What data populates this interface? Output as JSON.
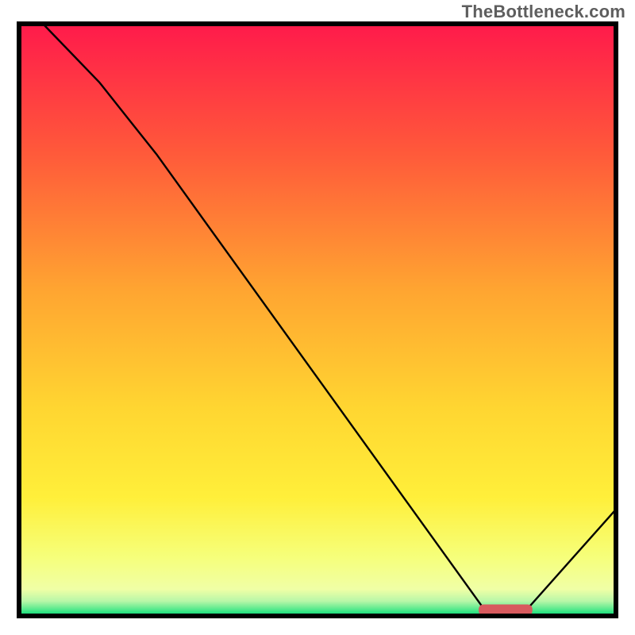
{
  "watermark": "TheBottleneck.com",
  "chart_data": {
    "type": "line",
    "title": "",
    "xlabel": "",
    "ylabel": "",
    "xlim": [
      0,
      100
    ],
    "ylim": [
      0,
      100
    ],
    "grid": false,
    "legend": false,
    "series": [
      {
        "name": "curve",
        "points": [
          {
            "x": 4,
            "y": 100
          },
          {
            "x": 23,
            "y": 78
          },
          {
            "x": 78,
            "y": 1
          },
          {
            "x": 85,
            "y": 1
          },
          {
            "x": 100,
            "y": 18
          }
        ]
      }
    ],
    "marker": {
      "x_start": 77,
      "x_end": 86,
      "y": 1,
      "color": "#d85a5e"
    },
    "gradient_stops": [
      {
        "offset": 0.0,
        "color": "#ff1a4b"
      },
      {
        "offset": 0.22,
        "color": "#ff5a3a"
      },
      {
        "offset": 0.45,
        "color": "#ffa531"
      },
      {
        "offset": 0.65,
        "color": "#ffd631"
      },
      {
        "offset": 0.8,
        "color": "#ffef3a"
      },
      {
        "offset": 0.9,
        "color": "#f6ff7a"
      },
      {
        "offset": 0.955,
        "color": "#f0ffa6"
      },
      {
        "offset": 0.975,
        "color": "#b8f7a8"
      },
      {
        "offset": 0.99,
        "color": "#4de88a"
      },
      {
        "offset": 1.0,
        "color": "#00d977"
      }
    ],
    "frame": {
      "stroke": "#000000",
      "stroke_width": 6
    }
  }
}
